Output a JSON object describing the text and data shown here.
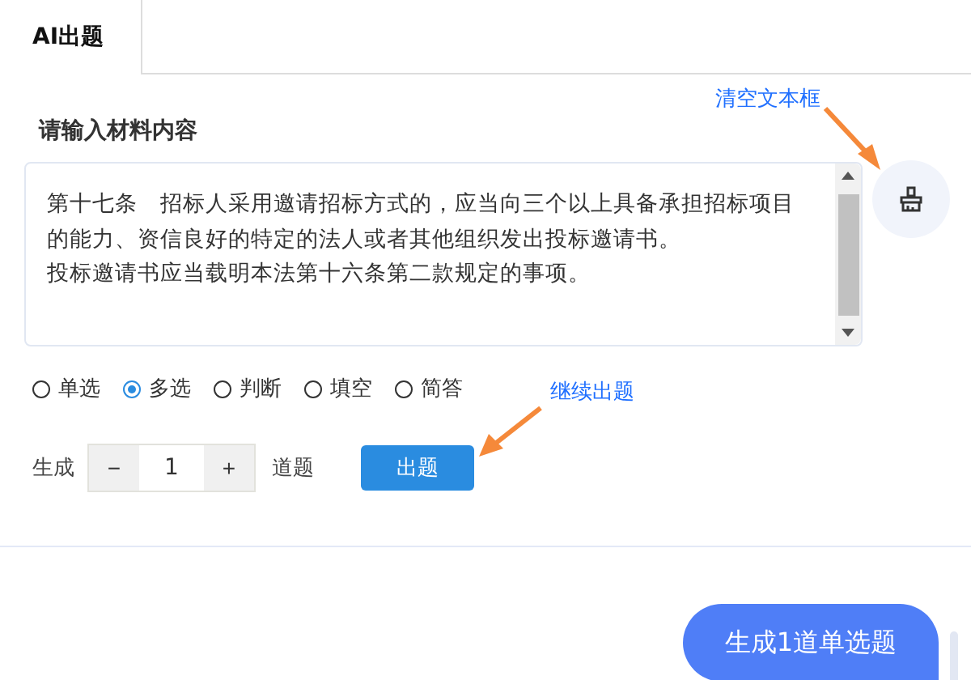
{
  "tabs": [
    {
      "label": "AI出题",
      "selected": true
    }
  ],
  "heading": "请输入材料内容",
  "material": {
    "paragraphs": [
      "第十七条　招标人采用邀请招标方式的，应当向三个以上具备承担招标项目的能力、资信良好的特定的法人或者其他组织发出投标邀请书。",
      "投标邀请书应当载明本法第十六条第二款规定的事项。"
    ]
  },
  "question_types": [
    {
      "label": "单选",
      "selected": false
    },
    {
      "label": "多选",
      "selected": true
    },
    {
      "label": "判断",
      "selected": false
    },
    {
      "label": "填空",
      "selected": false
    },
    {
      "label": "简答",
      "selected": false
    }
  ],
  "generate": {
    "prefix": "生成",
    "minus": "−",
    "count": "1",
    "plus": "+",
    "suffix": "道题",
    "button": "出题"
  },
  "chat": [
    {
      "text": "生成1道单选题"
    }
  ],
  "annotations": [
    {
      "kind": "clear",
      "text": "清空文本框"
    },
    {
      "kind": "continue",
      "text": "继续出题"
    }
  ]
}
